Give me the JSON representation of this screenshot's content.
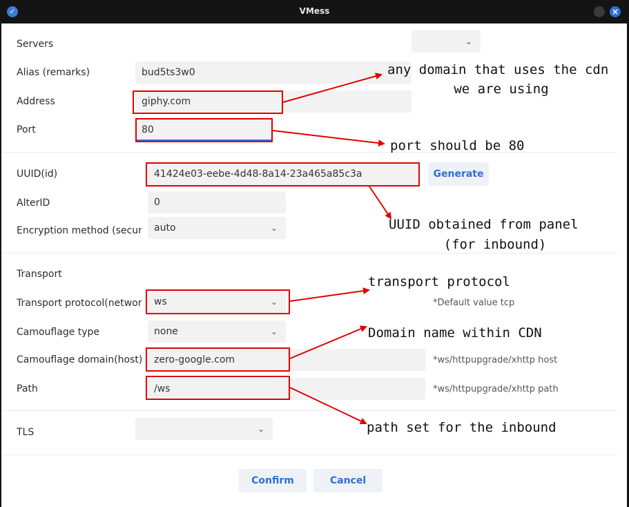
{
  "window": {
    "title": "VMess"
  },
  "labels": {
    "servers": "Servers",
    "alias": "Alias (remarks)",
    "address": "Address",
    "port": "Port",
    "uuid": "UUID(id)",
    "alterid": "AlterID",
    "encryption": "Encryption method (security)",
    "transport_section": "Transport",
    "network": "Transport protocol(network)",
    "camouflage_type": "Camouflage type",
    "camouflage_host": "Camouflage domain(host)",
    "path": "Path",
    "tls": "TLS"
  },
  "fields": {
    "servers": "",
    "alias": "bud5ts3w0",
    "address": "giphy.com",
    "port": "80",
    "uuid": "41424e03-eebe-4d48-8a14-23a465a85c3a",
    "alterid": "0",
    "encryption": "auto",
    "network": "ws",
    "camouflage_type": "none",
    "host": "zero-google.com",
    "path": "/ws",
    "tls": ""
  },
  "hints": {
    "network": "*Default value tcp",
    "host": "*ws/httpupgrade/xhttp host",
    "path": "*ws/httpupgrade/xhttp path"
  },
  "buttons": {
    "generate": "Generate",
    "confirm": "Confirm",
    "cancel": "Cancel"
  },
  "annotations": {
    "domain_line1": "any domain that uses the cdn",
    "domain_line2": "we are using",
    "port": "port should be 80",
    "uuid_line1": "UUID obtained from panel",
    "uuid_line2": "(for inbound)",
    "transport": "transport protocol",
    "cdn_domain": "Domain name within CDN",
    "path": "path set for the inbound"
  },
  "colors": {
    "accent": "#2f6fd6",
    "annotation": "#e00000"
  },
  "icons": {
    "dropdown": "chevron-down-icon",
    "close": "close-icon",
    "logo": "app-logo-icon"
  }
}
